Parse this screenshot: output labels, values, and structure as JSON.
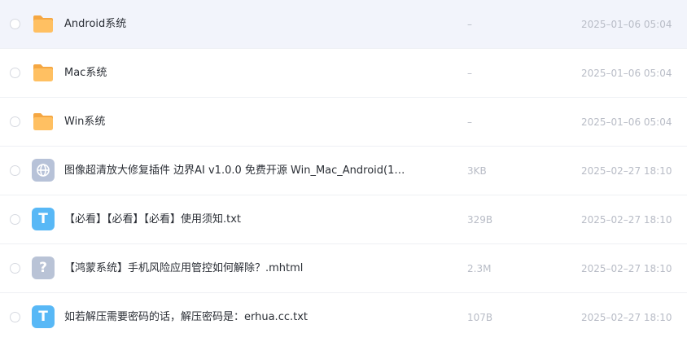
{
  "files": [
    {
      "name": "Android系统",
      "size": "–",
      "date": "2025–01–06 05:04",
      "type": "folder"
    },
    {
      "name": "Mac系统",
      "size": "–",
      "date": "2025–01–06 05:04",
      "type": "folder"
    },
    {
      "name": "Win系统",
      "size": "–",
      "date": "2025–01–06 05:04",
      "type": "folder"
    },
    {
      "name": "图像超清放大修复插件 边界AI v1.0.0 免费开源 Win_Mac_Android(1)....",
      "size": "3KB",
      "date": "2025–02–27 18:10",
      "type": "web"
    },
    {
      "name": "【必看】【必看】【必看】使用须知.txt",
      "size": "329B",
      "date": "2025–02–27 18:10",
      "type": "txt",
      "glyph": "T"
    },
    {
      "name": "【鸿蒙系统】手机风险应用管控如何解除？.mhtml",
      "size": "2.3M",
      "date": "2025–02–27 18:10",
      "type": "unknown",
      "glyph": "?"
    },
    {
      "name": "如若解压需要密码的话，解压密码是：erhua.cc.txt",
      "size": "107B",
      "date": "2025–02–27 18:10",
      "type": "txt",
      "glyph": "T"
    }
  ],
  "colors": {
    "highlight_row": "#f2f4fb",
    "folder": "#ffc062",
    "txt_icon": "#58b8f6",
    "muted_icon": "#b7c2d8"
  }
}
